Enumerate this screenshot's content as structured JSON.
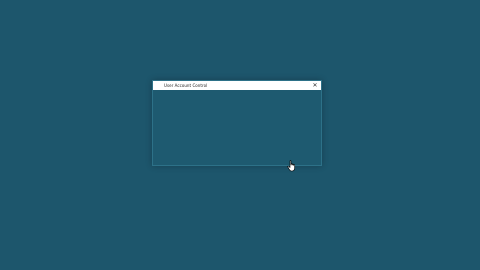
{
  "dialog": {
    "title": "User Account Control",
    "icon": "shield-icon",
    "close_glyph": "✕"
  },
  "cursor": {
    "icon": "hand-pointer-icon"
  },
  "colors": {
    "desktop_background": "#1d566c",
    "dialog_body": "#1e5a70",
    "titlebar": "#ffffff"
  }
}
